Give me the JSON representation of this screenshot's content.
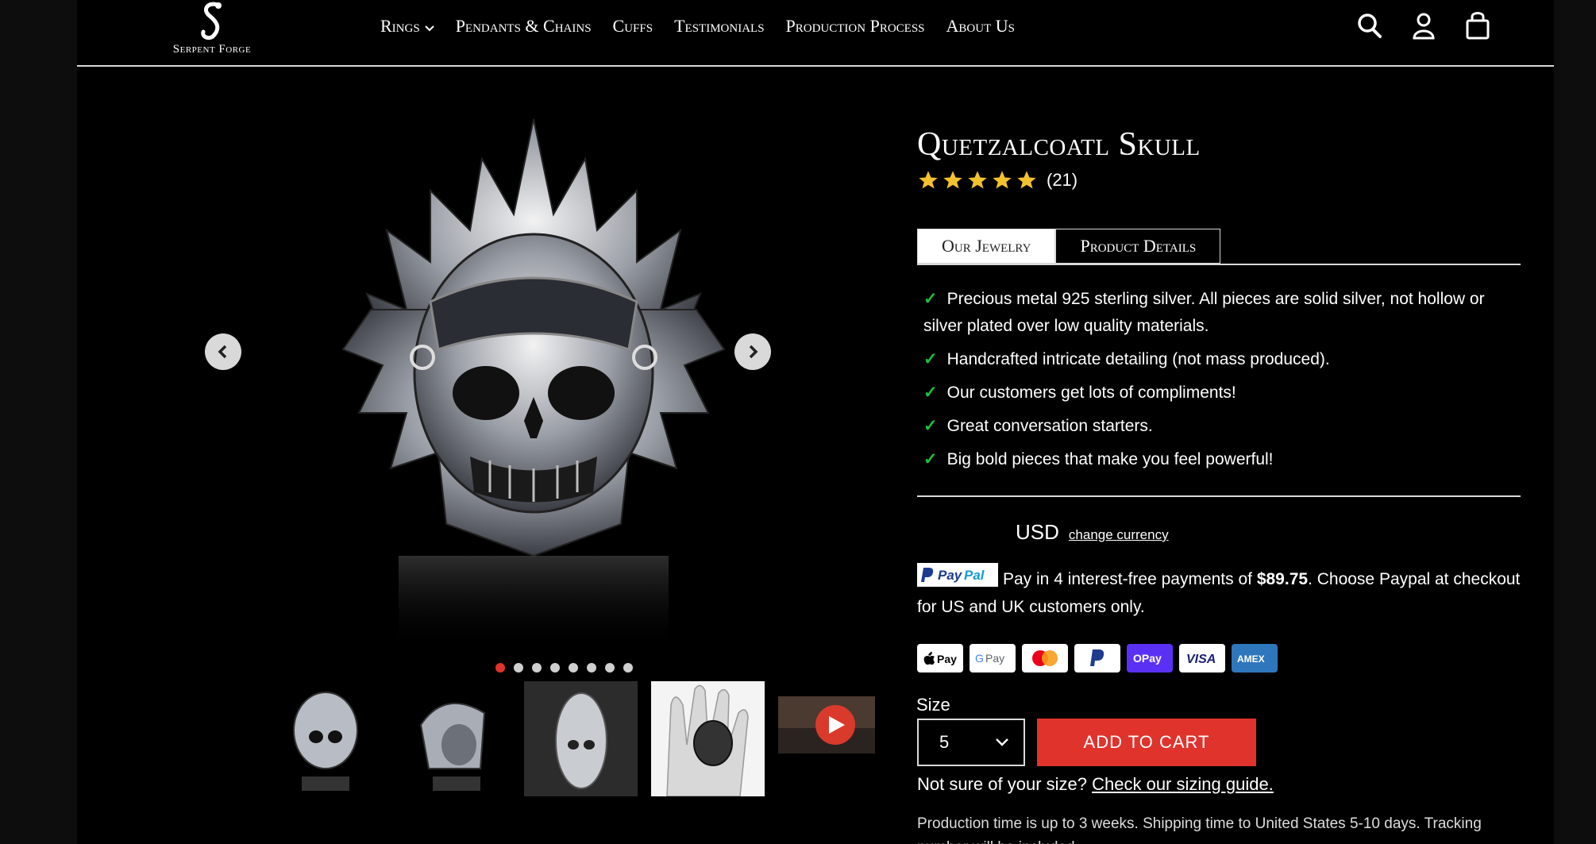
{
  "header": {
    "logo_text": "Serpent Forge",
    "nav": [
      {
        "label": "Rings",
        "has_dropdown": true
      },
      {
        "label": "Pendants & Chains"
      },
      {
        "label": "Cuffs"
      },
      {
        "label": "Testimonials"
      },
      {
        "label": "Production Process"
      },
      {
        "label": "About Us"
      }
    ],
    "icons": [
      "search-icon",
      "account-icon",
      "cart-icon"
    ]
  },
  "gallery": {
    "dots_total": 8,
    "active_dot": 1,
    "thumbnails": [
      "ring-front",
      "ring-side",
      "ring-tall",
      "ring-on-hand",
      "video"
    ]
  },
  "product": {
    "title": "Quetzalcoatl Skull",
    "rating_stars": 5,
    "review_count": "(21)",
    "tabs": [
      "Our Jewelry",
      "Product Details"
    ],
    "features": [
      "Precious metal 925 sterling silver. All pieces are solid silver, not hollow or silver plated over low quality materials.",
      "Handcrafted intricate detailing (not mass produced).",
      "Our customers get lots of compliments!",
      "Great conversation starters.",
      "Big bold pieces that make you feel powerful!"
    ],
    "currency": {
      "code": "USD",
      "link": "change currency"
    },
    "paypal": {
      "prefix": "Pay in 4 interest-free payments of ",
      "amount": "$89.75",
      "suffix": ". Choose Paypal at checkout for US and UK customers only."
    },
    "payment_methods": [
      "Apple Pay",
      "G Pay",
      "Mastercard",
      "PayPal",
      "Shop Pay",
      "VISA",
      "AMEX"
    ],
    "size_label": "Size",
    "size_value": "5",
    "add_to_cart": "ADD TO CART",
    "sizing_text": "Not sure of your size?",
    "sizing_link": "Check our sizing guide.",
    "production_text": "Production time is up to 3 weeks. Shipping time to United States 5-10 days. Tracking number will be included."
  },
  "colors": {
    "accent": "#e0332c",
    "check": "#1bc23a",
    "background": "#000000"
  }
}
